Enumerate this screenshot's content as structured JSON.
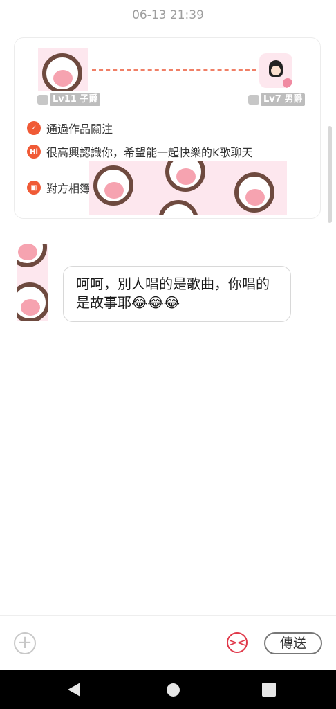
{
  "timestamp": "06-13 21:39",
  "profile_card": {
    "left_user": {
      "level": "Lv11",
      "title": "子爵"
    },
    "right_user": {
      "level": "Lv7",
      "title": "男爵"
    },
    "rows": [
      {
        "icon": "person-follow-icon",
        "text": "通過作品關注"
      },
      {
        "icon": "hi-icon",
        "icon_text": "Hi",
        "text": "很高興認識你，希望能一起快樂的K歌聊天"
      },
      {
        "icon": "photo-album-icon",
        "text": "對方相簿"
      }
    ]
  },
  "message": {
    "text": "呵呵，別人唱的是歌曲，你唱的是故事耶😂😂😂"
  },
  "input_bar": {
    "send_label": "傳送"
  },
  "colors": {
    "accent": "#f05a36",
    "dash_line": "#f07f66",
    "emoji_button": "#e0394a",
    "paw_background": "#fde7ee"
  }
}
